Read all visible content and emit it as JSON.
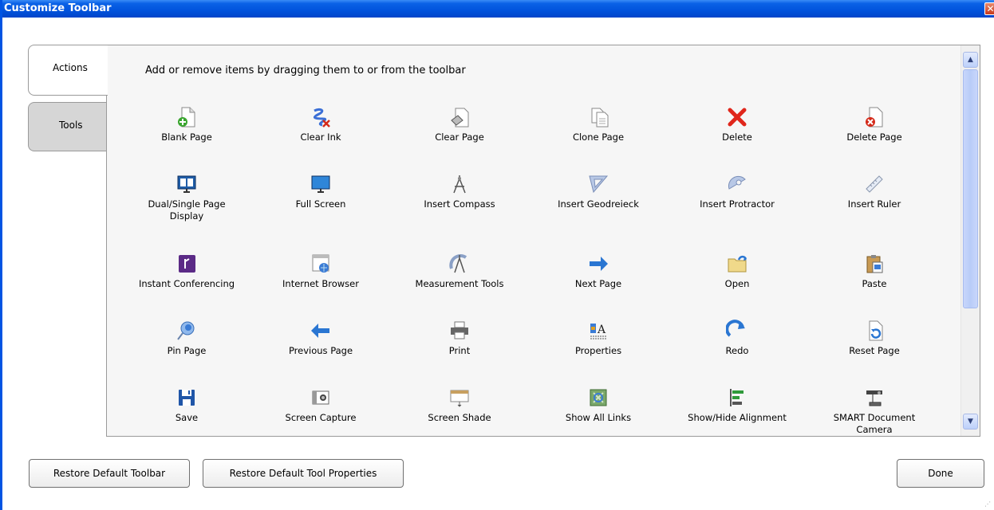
{
  "window": {
    "title": "Customize Toolbar",
    "close_glyph": "✕"
  },
  "tabs": [
    {
      "label": "Actions",
      "selected": true
    },
    {
      "label": "Tools",
      "selected": false
    }
  ],
  "instructions": "Add or remove items by dragging them to or from the toolbar",
  "items": [
    {
      "label": "Blank Page",
      "icon": "blank-page-icon"
    },
    {
      "label": "Clear Ink",
      "icon": "clear-ink-icon"
    },
    {
      "label": "Clear Page",
      "icon": "clear-page-icon"
    },
    {
      "label": "Clone Page",
      "icon": "clone-page-icon"
    },
    {
      "label": "Delete",
      "icon": "delete-icon"
    },
    {
      "label": "Delete Page",
      "icon": "delete-page-icon"
    },
    {
      "label": "Dual/Single Page Display",
      "icon": "dual-single-page-display-icon"
    },
    {
      "label": "Full Screen",
      "icon": "full-screen-icon"
    },
    {
      "label": "Insert Compass",
      "icon": "compass-icon"
    },
    {
      "label": "Insert Geodreieck",
      "icon": "geodreieck-icon"
    },
    {
      "label": "Insert Protractor",
      "icon": "protractor-icon"
    },
    {
      "label": "Insert Ruler",
      "icon": "ruler-icon"
    },
    {
      "label": "Instant Conferencing",
      "icon": "instant-conferencing-icon"
    },
    {
      "label": "Internet Browser",
      "icon": "internet-browser-icon"
    },
    {
      "label": "Measurement Tools",
      "icon": "measurement-tools-icon"
    },
    {
      "label": "Next Page",
      "icon": "arrow-right-icon"
    },
    {
      "label": "Open",
      "icon": "open-folder-icon"
    },
    {
      "label": "Paste",
      "icon": "paste-icon"
    },
    {
      "label": "Pin Page",
      "icon": "pin-page-icon"
    },
    {
      "label": "Previous Page",
      "icon": "arrow-left-icon"
    },
    {
      "label": "Print",
      "icon": "printer-icon"
    },
    {
      "label": "Properties",
      "icon": "properties-icon"
    },
    {
      "label": "Redo",
      "icon": "redo-icon"
    },
    {
      "label": "Reset Page",
      "icon": "reset-page-icon"
    },
    {
      "label": "Save",
      "icon": "save-icon"
    },
    {
      "label": "Screen Capture",
      "icon": "camera-icon"
    },
    {
      "label": "Screen Shade",
      "icon": "screen-shade-icon"
    },
    {
      "label": "Show All Links",
      "icon": "show-all-links-icon"
    },
    {
      "label": "Show/Hide Alignment",
      "icon": "alignment-icon"
    },
    {
      "label": "SMART Document Camera",
      "icon": "document-camera-icon"
    }
  ],
  "scrollbar": {
    "up_glyph": "▲",
    "down_glyph": "▼"
  },
  "buttons": {
    "restore_toolbar": "Restore Default Toolbar",
    "restore_tool_properties": "Restore Default Tool Properties",
    "done": "Done"
  },
  "colors": {
    "titlebar": "#0153dc",
    "delete_red": "#e0261b",
    "arrow_blue": "#2a76d2",
    "green_plus": "#3aa52f"
  }
}
